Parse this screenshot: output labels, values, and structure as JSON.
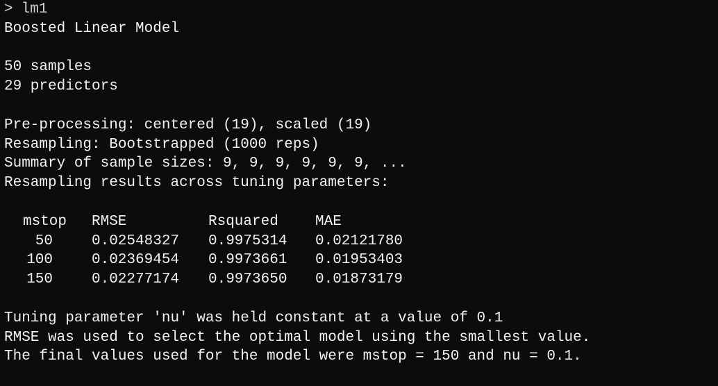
{
  "console": {
    "prompt_symbol": ">",
    "command": "lm1",
    "model_title": "Boosted Linear Model",
    "samples_line": "50 samples",
    "predictors_line": "29 predictors",
    "preprocessing_line": "Pre-processing: centered (19), scaled (19)",
    "resampling_line": "Resampling: Bootstrapped (1000 reps)",
    "sample_sizes_line": "Summary of sample sizes: 9, 9, 9, 9, 9, 9, ...",
    "results_header_line": "Resampling results across tuning parameters:",
    "table": {
      "headers": [
        "mstop",
        "RMSE",
        "Rsquared",
        "MAE"
      ],
      "rows": [
        [
          "50",
          "0.02548327",
          "0.9975314",
          "0.02121780"
        ],
        [
          "100",
          "0.02369454",
          "0.9973661",
          "0.01953403"
        ],
        [
          "150",
          "0.02277174",
          "0.9973650",
          "0.01873179"
        ]
      ]
    },
    "tuning_note_line": "Tuning parameter 'nu' was held constant at a value of 0.1",
    "selection_line": "RMSE was used to select the optimal model using the smallest value.",
    "final_values_line": "The final values used for the model were mstop = 150 and nu = 0.1."
  }
}
